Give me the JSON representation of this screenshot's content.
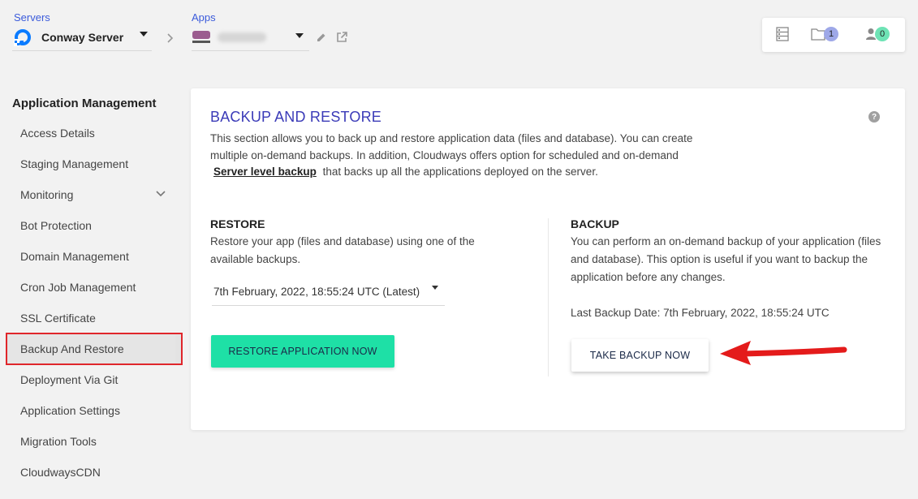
{
  "breadcrumb": {
    "servers_label": "Servers",
    "server_name": "Conway Server",
    "apps_label": "Apps"
  },
  "toolbar": {
    "files_count": "1",
    "users_count": "0"
  },
  "sidebar": {
    "title": "Application Management",
    "items": [
      {
        "label": "Access Details"
      },
      {
        "label": "Staging Management"
      },
      {
        "label": "Monitoring"
      },
      {
        "label": "Bot Protection"
      },
      {
        "label": "Domain Management"
      },
      {
        "label": "Cron Job Management"
      },
      {
        "label": "SSL Certificate"
      },
      {
        "label": "Backup And Restore"
      },
      {
        "label": "Deployment Via Git"
      },
      {
        "label": "Application Settings"
      },
      {
        "label": "Migration Tools"
      },
      {
        "label": "CloudwaysCDN"
      }
    ]
  },
  "main": {
    "title": "BACKUP AND RESTORE",
    "help_icon": "?",
    "description_before": "This section allows you to back up and restore application data (files and database). You can create multiple on-demand backups. In addition, Cloudways offers option for scheduled and on-demand",
    "description_link": "Server level backup",
    "description_after": "that backs up all the applications deployed on the server.",
    "restore": {
      "title": "RESTORE",
      "text": "Restore your app (files and database) using one of the available backups.",
      "selected_backup": "7th February, 2022, 18:55:24 UTC (Latest)",
      "button": "RESTORE APPLICATION NOW"
    },
    "backup": {
      "title": "BACKUP",
      "text": "You can perform an on-demand backup of your application (files and database). This option is useful if you want to backup the application before any changes.",
      "last_backup": "Last Backup Date: 7th February, 2022, 18:55:24 UTC",
      "button": "TAKE BACKUP NOW"
    }
  },
  "colors": {
    "accent": "#3b3bb8",
    "restore_button": "#1ee0a6",
    "highlight": "#e0262b"
  }
}
